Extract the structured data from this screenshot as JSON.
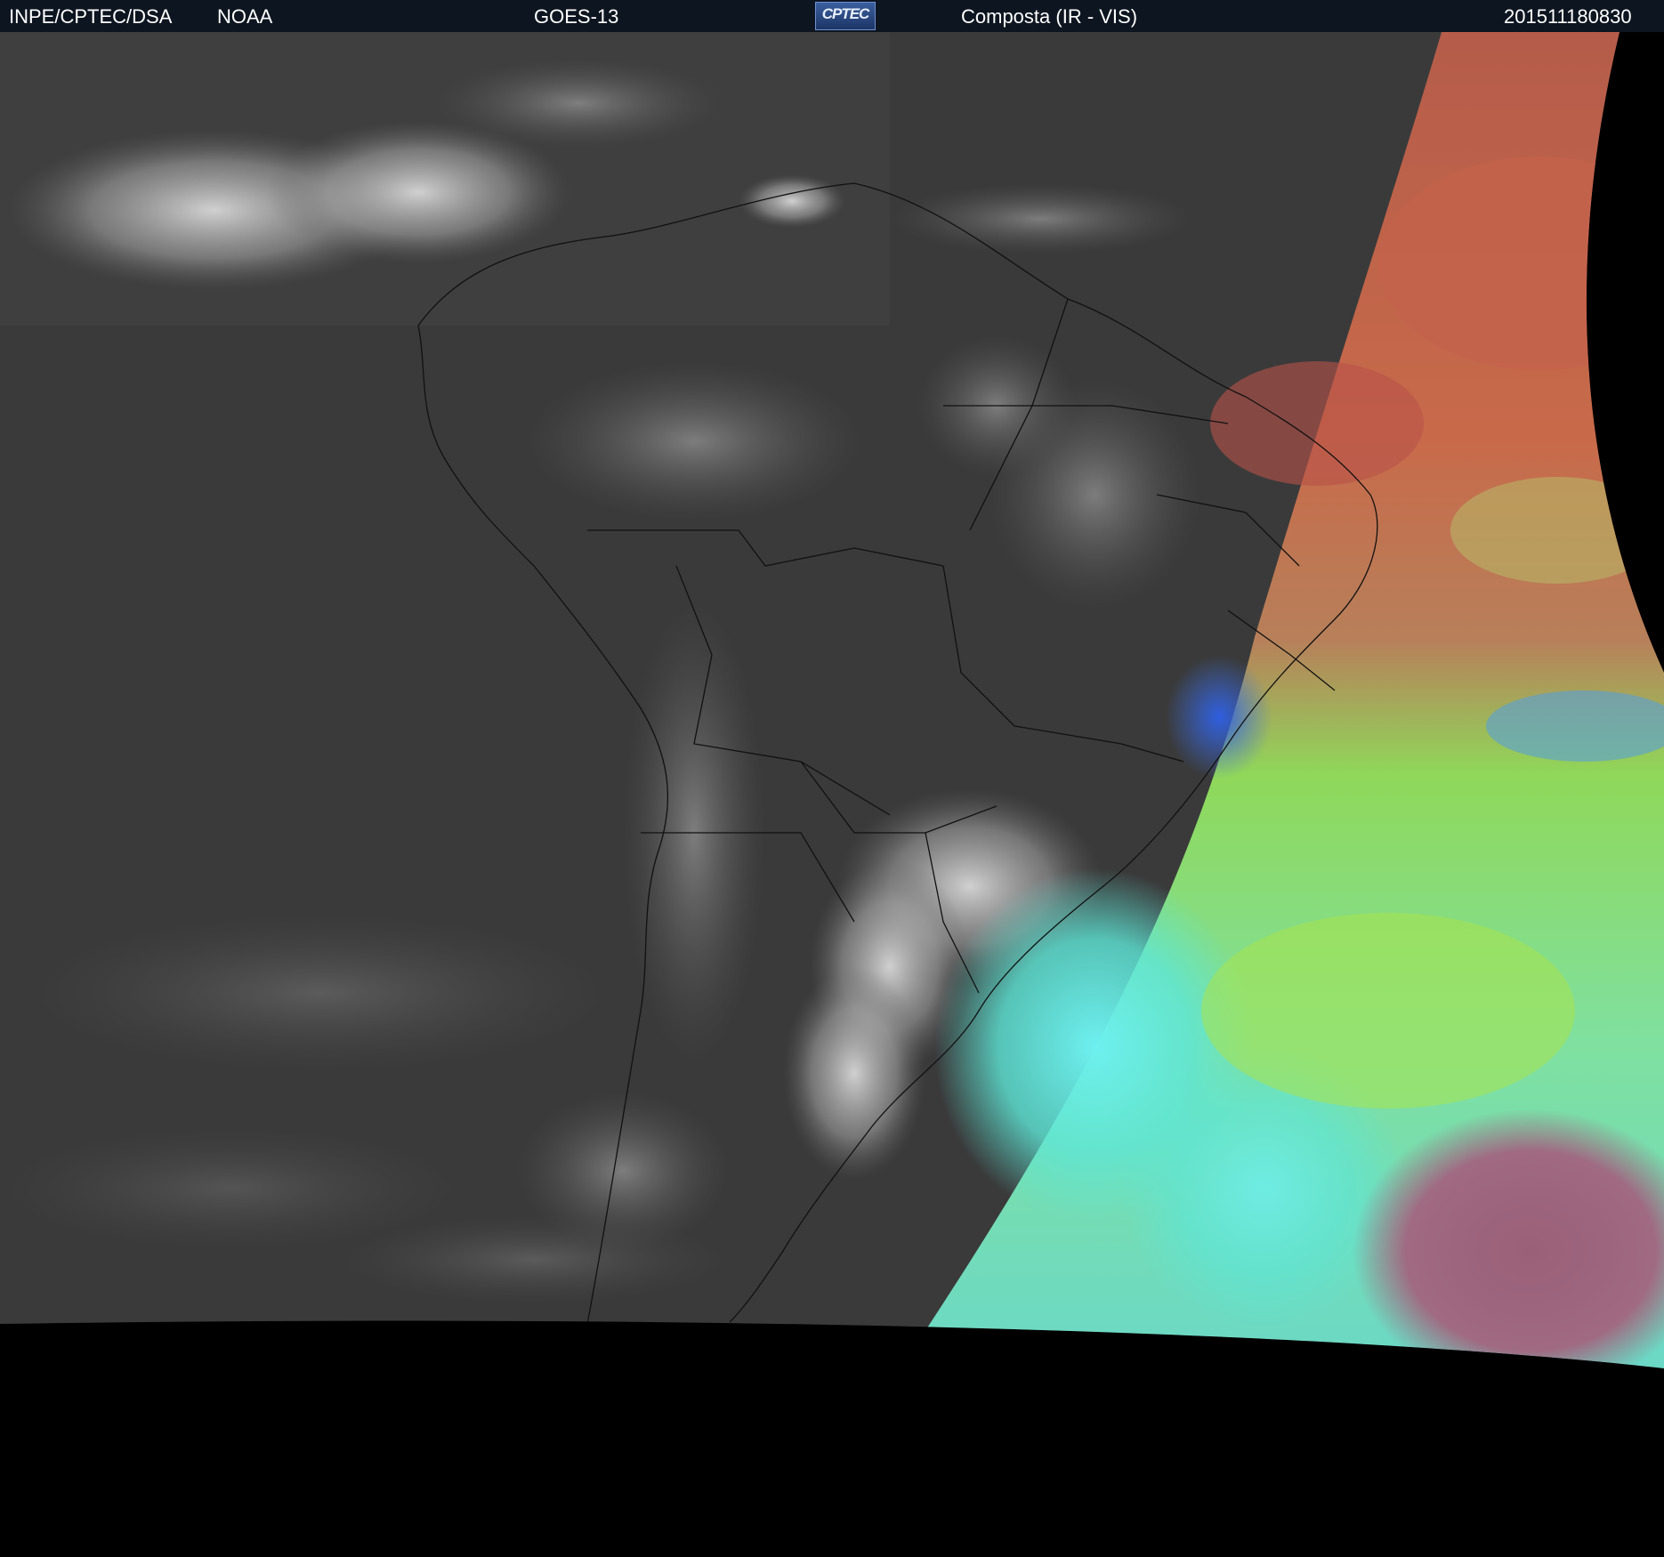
{
  "header": {
    "agency": "INPE/CPTEC/DSA",
    "provider": "NOAA",
    "satellite": "GOES-13",
    "logo_text": "CPTEC",
    "product": "Composta (IR - VIS)",
    "timestamp": "201511180830"
  },
  "colors": {
    "header_bg": "#0d1520",
    "ir_background": "#3a3a3a",
    "space": "#000000",
    "vis_red": "#c0604a",
    "vis_green": "#a8e44c",
    "vis_cyan": "#5ee6d6",
    "vis_blue": "#3f6fe0",
    "vis_pink": "#a06a82"
  }
}
